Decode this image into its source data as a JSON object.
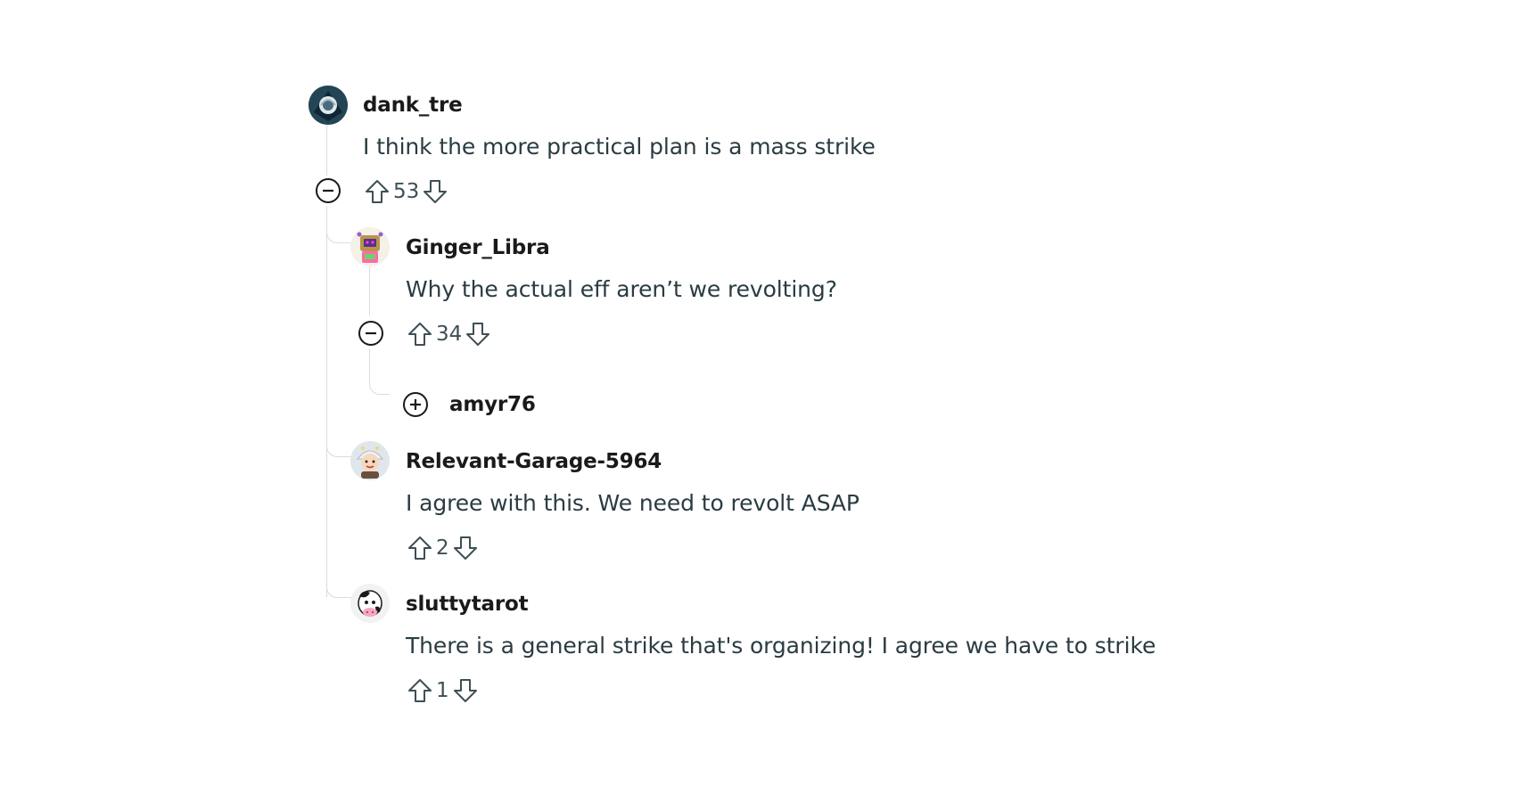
{
  "comments": [
    {
      "username": "dank_tre",
      "body": "I think the more practical plan is a mass strike",
      "score": "53",
      "collapse_icon": "minus-circle-icon",
      "avatar_icon": "avatar-dark-helmet-icon"
    },
    {
      "username": "Ginger_Libra",
      "body": "Why the actual eff aren’t we revolting?",
      "score": "34",
      "collapse_icon": "minus-circle-icon",
      "avatar_icon": "avatar-robot-icon"
    },
    {
      "username": "amyr76",
      "collapsed": true,
      "expand_icon": "plus-circle-icon"
    },
    {
      "username": "Relevant-Garage-5964",
      "body": "I agree with this. We need to revolt ASAP",
      "score": "2",
      "avatar_icon": "avatar-helmet-character-icon"
    },
    {
      "username": "sluttytarot",
      "body": "There is a general strike that's organizing! I agree we have to strike",
      "score": "1",
      "avatar_icon": "avatar-cow-character-icon"
    }
  ],
  "colors": {
    "thread_line": "#d9dde0",
    "icon_stroke": "#3f4f55",
    "body_text": "#2a3c42",
    "username_text": "#1a1a1b"
  }
}
